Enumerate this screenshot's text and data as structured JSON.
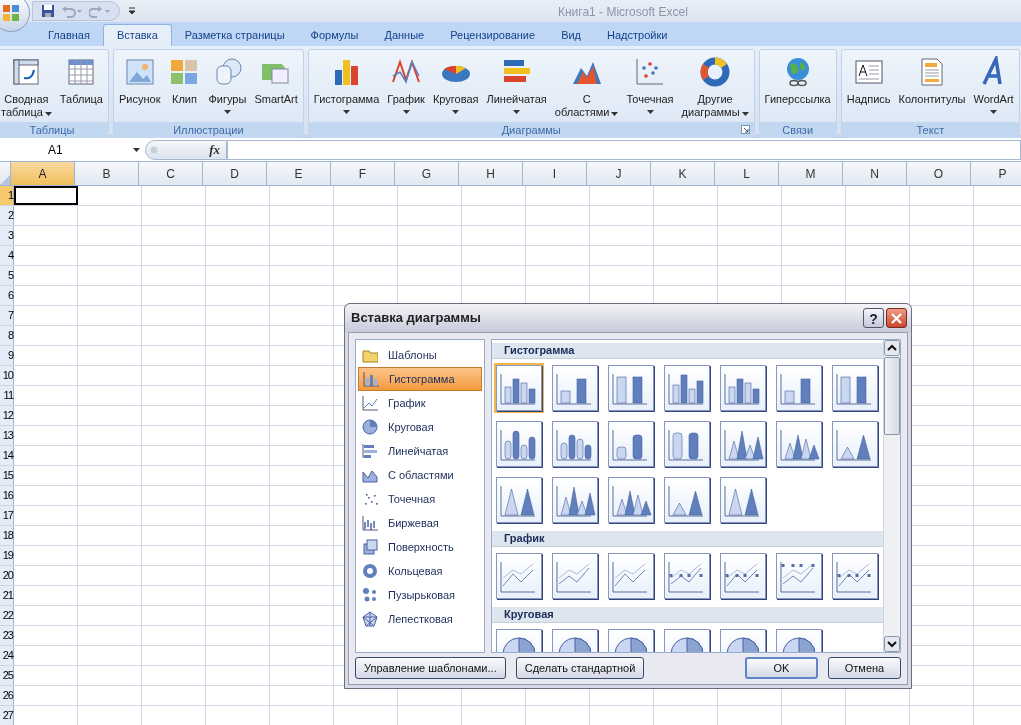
{
  "title_bar": {
    "title": "Книга1 - Microsoft Excel"
  },
  "tabs": [
    {
      "label": "Главная",
      "selected": false
    },
    {
      "label": "Вставка",
      "selected": true
    },
    {
      "label": "Разметка страницы",
      "selected": false
    },
    {
      "label": "Формулы",
      "selected": false
    },
    {
      "label": "Данные",
      "selected": false
    },
    {
      "label": "Рецензирование",
      "selected": false
    },
    {
      "label": "Вид",
      "selected": false
    },
    {
      "label": "Надстройки",
      "selected": false
    }
  ],
  "ribbon": {
    "groups": [
      {
        "label": "Таблицы",
        "launcher": false,
        "buttons": [
          {
            "lines": [
              "Сводная",
              "таблица"
            ],
            "dropdown": true
          },
          {
            "lines": [
              "Таблица"
            ],
            "dropdown": false
          }
        ]
      },
      {
        "label": "Иллюстрации",
        "launcher": false,
        "buttons": [
          {
            "lines": [
              "Рисунок"
            ],
            "dropdown": false
          },
          {
            "lines": [
              "Клип"
            ],
            "dropdown": false
          },
          {
            "lines": [
              "Фигуры"
            ],
            "dropdown": true
          },
          {
            "lines": [
              "SmartArt"
            ],
            "dropdown": false
          }
        ]
      },
      {
        "label": "Диаграммы",
        "launcher": true,
        "buttons": [
          {
            "lines": [
              "Гистограмма"
            ],
            "dropdown": true
          },
          {
            "lines": [
              "График"
            ],
            "dropdown": true
          },
          {
            "lines": [
              "Круговая"
            ],
            "dropdown": true
          },
          {
            "lines": [
              "Линейчатая"
            ],
            "dropdown": true
          },
          {
            "lines": [
              "С",
              "областями"
            ],
            "dropdown": true
          },
          {
            "lines": [
              "Точечная"
            ],
            "dropdown": true
          },
          {
            "lines": [
              "Другие",
              "диаграммы"
            ],
            "dropdown": true
          }
        ]
      },
      {
        "label": "Связи",
        "launcher": false,
        "buttons": [
          {
            "lines": [
              "Гиперссылка"
            ],
            "dropdown": false
          }
        ]
      },
      {
        "label": "Текст",
        "launcher": false,
        "buttons": [
          {
            "lines": [
              "Надпись"
            ],
            "dropdown": false
          },
          {
            "lines": [
              "Колонтитулы"
            ],
            "dropdown": false
          },
          {
            "lines": [
              "WordArt"
            ],
            "dropdown": true
          }
        ]
      }
    ]
  },
  "formula_bar": {
    "name_box": "A1",
    "fx": "fx"
  },
  "sheet": {
    "columns": [
      {
        "label": "A",
        "selected": true
      },
      {
        "label": "B",
        "selected": false
      },
      {
        "label": "C",
        "selected": false
      },
      {
        "label": "D",
        "selected": false
      },
      {
        "label": "E",
        "selected": false
      },
      {
        "label": "F",
        "selected": false
      },
      {
        "label": "G",
        "selected": false
      },
      {
        "label": "H",
        "selected": false
      },
      {
        "label": "I",
        "selected": false
      },
      {
        "label": "J",
        "selected": false
      },
      {
        "label": "K",
        "selected": false
      },
      {
        "label": "L",
        "selected": false
      },
      {
        "label": "M",
        "selected": false
      },
      {
        "label": "N",
        "selected": false
      },
      {
        "label": "O",
        "selected": false
      },
      {
        "label": "P",
        "selected": false
      }
    ],
    "rows": [
      {
        "label": "1",
        "selected": true
      },
      {
        "label": "2",
        "selected": false
      },
      {
        "label": "3",
        "selected": false
      },
      {
        "label": "4",
        "selected": false
      },
      {
        "label": "5",
        "selected": false
      },
      {
        "label": "6",
        "selected": false
      },
      {
        "label": "7",
        "selected": false
      },
      {
        "label": "8",
        "selected": false
      },
      {
        "label": "9",
        "selected": false
      },
      {
        "label": "10",
        "selected": false
      },
      {
        "label": "11",
        "selected": false
      },
      {
        "label": "12",
        "selected": false
      },
      {
        "label": "13",
        "selected": false
      },
      {
        "label": "14",
        "selected": false
      },
      {
        "label": "15",
        "selected": false
      },
      {
        "label": "16",
        "selected": false
      },
      {
        "label": "17",
        "selected": false
      },
      {
        "label": "18",
        "selected": false
      },
      {
        "label": "19",
        "selected": false
      },
      {
        "label": "20",
        "selected": false
      },
      {
        "label": "21",
        "selected": false
      },
      {
        "label": "22",
        "selected": false
      },
      {
        "label": "23",
        "selected": false
      },
      {
        "label": "24",
        "selected": false
      },
      {
        "label": "25",
        "selected": false
      },
      {
        "label": "26",
        "selected": false
      },
      {
        "label": "27",
        "selected": false
      }
    ]
  },
  "dialog": {
    "title": "Вставка диаграммы",
    "help": "?",
    "categories": [
      {
        "label": "Шаблоны",
        "selected": false
      },
      {
        "label": "Гистограмма",
        "selected": true
      },
      {
        "label": "График",
        "selected": false
      },
      {
        "label": "Круговая",
        "selected": false
      },
      {
        "label": "Линейчатая",
        "selected": false
      },
      {
        "label": "С областями",
        "selected": false
      },
      {
        "label": "Точечная",
        "selected": false
      },
      {
        "label": "Биржевая",
        "selected": false
      },
      {
        "label": "Поверхность",
        "selected": false
      },
      {
        "label": "Кольцевая",
        "selected": false
      },
      {
        "label": "Пузырьковая",
        "selected": false
      },
      {
        "label": "Лепестковая",
        "selected": false
      }
    ],
    "sections": [
      {
        "title": "Гистограмма",
        "items": [
          {
            "selected": true
          },
          {
            "selected": false
          },
          {
            "selected": false
          },
          {
            "selected": false
          },
          {
            "selected": false
          },
          {
            "selected": false
          },
          {
            "selected": false
          },
          {
            "selected": false
          },
          {
            "selected": false
          },
          {
            "selected": false
          },
          {
            "selected": false
          },
          {
            "selected": false
          },
          {
            "selected": false
          },
          {
            "selected": false
          },
          {
            "selected": false
          },
          {
            "selected": false
          },
          {
            "selected": false
          },
          {
            "selected": false
          },
          {
            "selected": false
          }
        ]
      },
      {
        "title": "График",
        "items": [
          {
            "selected": false
          },
          {
            "selected": false
          },
          {
            "selected": false
          },
          {
            "selected": false
          },
          {
            "selected": false
          },
          {
            "selected": false
          },
          {
            "selected": false
          }
        ]
      },
      {
        "title": "Круговая",
        "items": [
          {
            "selected": false
          },
          {
            "selected": false
          },
          {
            "selected": false
          },
          {
            "selected": false
          },
          {
            "selected": false
          },
          {
            "selected": false
          }
        ]
      }
    ],
    "buttons": [
      {
        "label": "Управление шаблонами...",
        "default": false
      },
      {
        "label": "Сделать стандартной",
        "default": false
      },
      {
        "label": "OK",
        "default": true
      },
      {
        "label": "Отмена",
        "default": false
      }
    ]
  }
}
